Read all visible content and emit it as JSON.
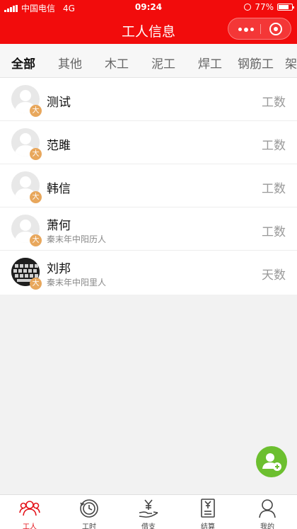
{
  "status_bar": {
    "carrier": "中国电信",
    "network": "4G",
    "time": "09:24",
    "battery": "77%"
  },
  "nav": {
    "title": "工人信息"
  },
  "tabs": [
    "全部",
    "其他",
    "木工",
    "泥工",
    "焊工",
    "钢筋工",
    "架"
  ],
  "workers": [
    {
      "name": "测试",
      "subtitle": "",
      "badge": "大",
      "type": "工数",
      "avatar": "default"
    },
    {
      "name": "范雎",
      "subtitle": "",
      "badge": "大",
      "type": "工数",
      "avatar": "default"
    },
    {
      "name": "韩信",
      "subtitle": "",
      "badge": "大",
      "type": "工数",
      "avatar": "default"
    },
    {
      "name": "萧何",
      "subtitle": "秦末年中阳历人",
      "badge": "大",
      "type": "工数",
      "avatar": "default"
    },
    {
      "name": "刘邦",
      "subtitle": "秦末年中阳里人",
      "badge": "大",
      "type": "天数",
      "avatar": "photo"
    }
  ],
  "bottom_nav": [
    {
      "label": "工人",
      "icon": "workers-icon",
      "active": true
    },
    {
      "label": "工时",
      "icon": "clock-icon",
      "active": false
    },
    {
      "label": "借支",
      "icon": "yen-hand-icon",
      "active": false
    },
    {
      "label": "结算",
      "icon": "receipt-icon",
      "active": false
    },
    {
      "label": "我的",
      "icon": "user-icon",
      "active": false
    }
  ],
  "colors": {
    "brand_red": "#f20c0c",
    "active_tab": "#e4141b",
    "badge": "#e8a75c",
    "fab": "#6cbf2f"
  }
}
